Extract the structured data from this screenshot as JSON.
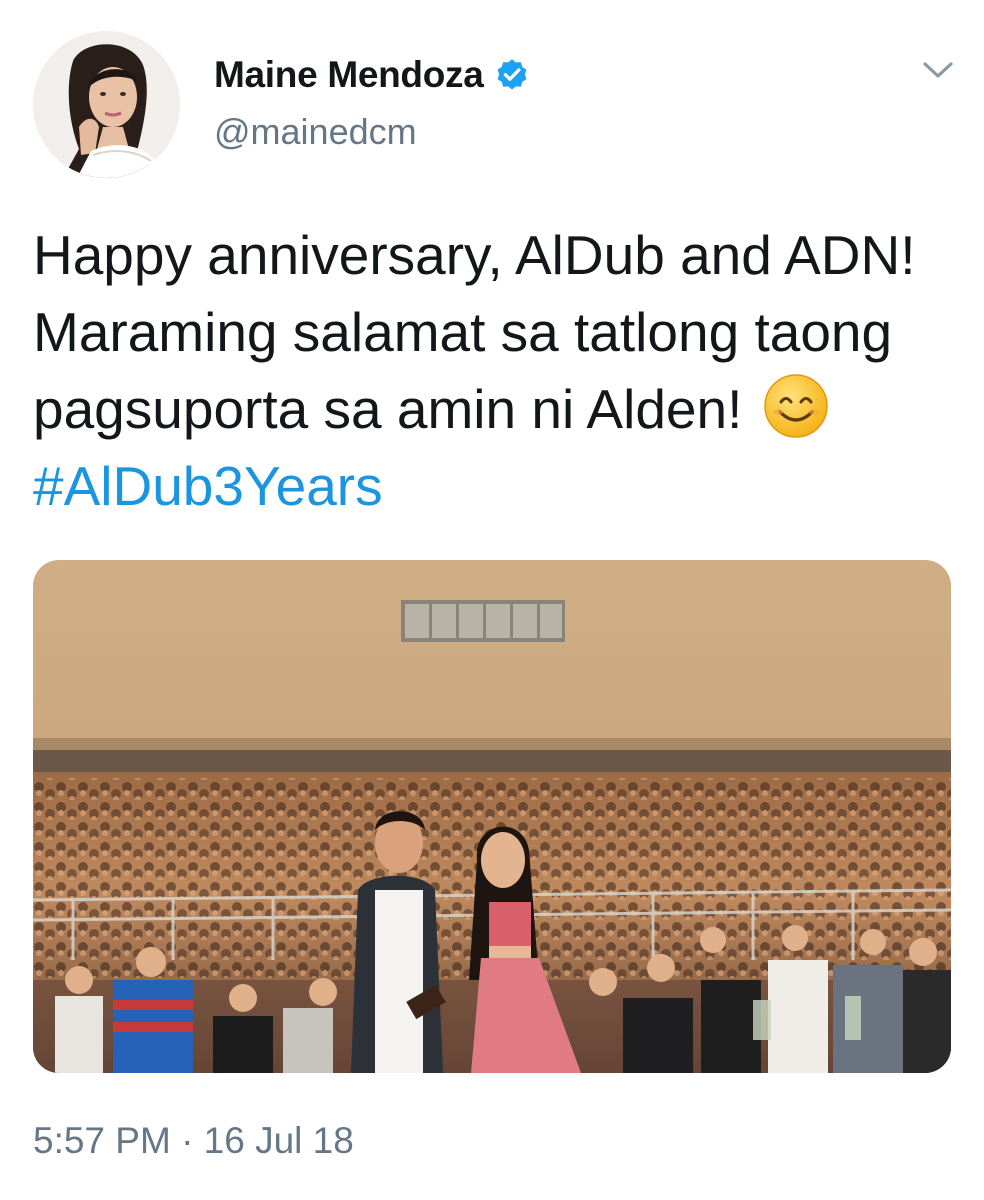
{
  "tweet": {
    "display_name": "Maine Mendoza",
    "handle": "@mainedcm",
    "verified_icon": "verified-badge-icon",
    "more_icon": "chevron-down-icon",
    "text_part1": "Happy anniversary, AlDub and ADN! Maraming salamat sa tatlong taong pagsuporta sa amin ni Alden! ",
    "emoji": "smiling-face-icon",
    "hashtag": "#AlDub3Years",
    "timestamp": "5:57 PM · 16 Jul 18"
  },
  "colors": {
    "text": "#14171a",
    "secondary": "#657786",
    "link": "#1b95e0",
    "verified": "#1da1f2"
  }
}
